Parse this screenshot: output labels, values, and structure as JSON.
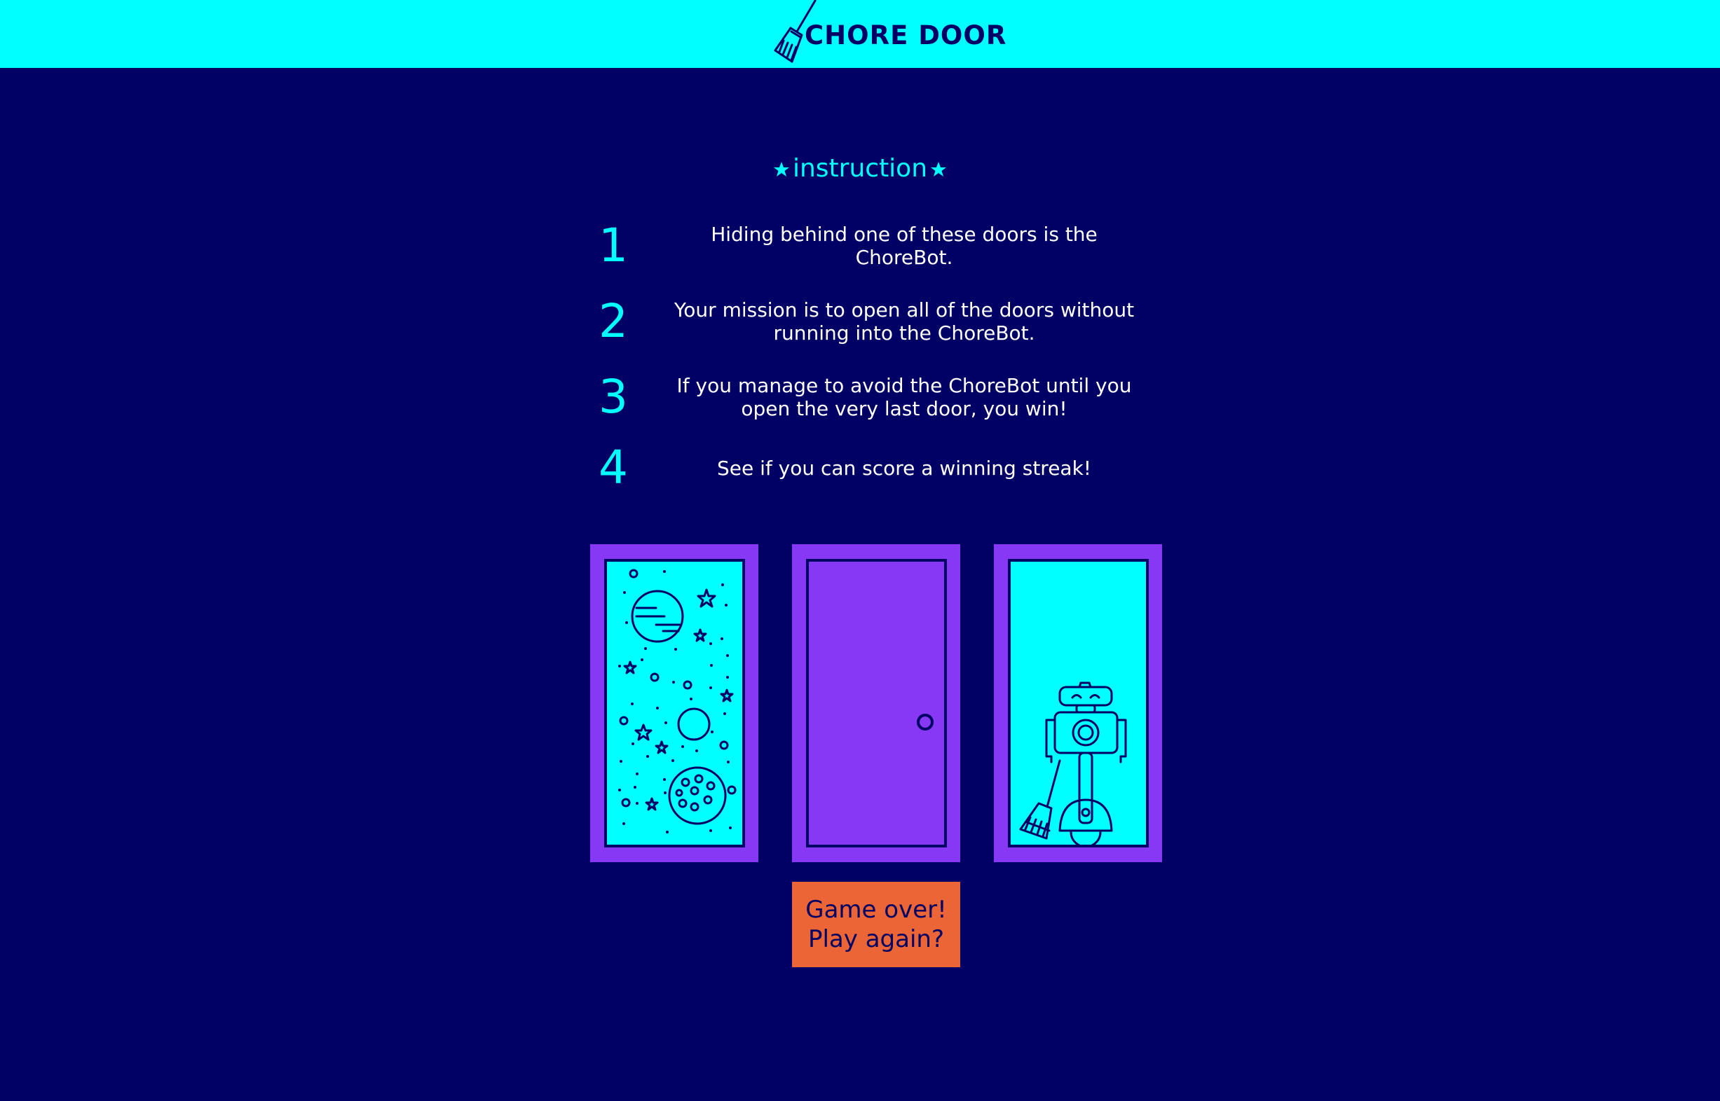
{
  "header": {
    "title": "CHORE DOOR",
    "logo_icon": "broom-icon",
    "background": "#00ffff"
  },
  "instructions": {
    "title": "instruction",
    "title_icon": "star-icon",
    "steps": [
      {
        "number": "1",
        "text": "Hiding behind one of these doors is the ChoreBot."
      },
      {
        "number": "2",
        "text": "Your mission is to open all of the doors without running into the ChoreBot."
      },
      {
        "number": "3",
        "text": "If you manage to avoid the ChoreBot until you open the very last door, you win!"
      },
      {
        "number": "4",
        "text": "See if you can score a winning streak!"
      }
    ]
  },
  "doors": [
    {
      "state": "open",
      "content": "space-icon"
    },
    {
      "state": "closed",
      "content": "door-knob-icon"
    },
    {
      "state": "open",
      "content": "chorebot-icon"
    }
  ],
  "button": {
    "line1": "Game over!",
    "line2": "Play again?"
  },
  "colors": {
    "background": "#010165",
    "accent": "#00ffff",
    "door": "#8638f4",
    "button": "#eb6536",
    "text": "#ffffff"
  }
}
